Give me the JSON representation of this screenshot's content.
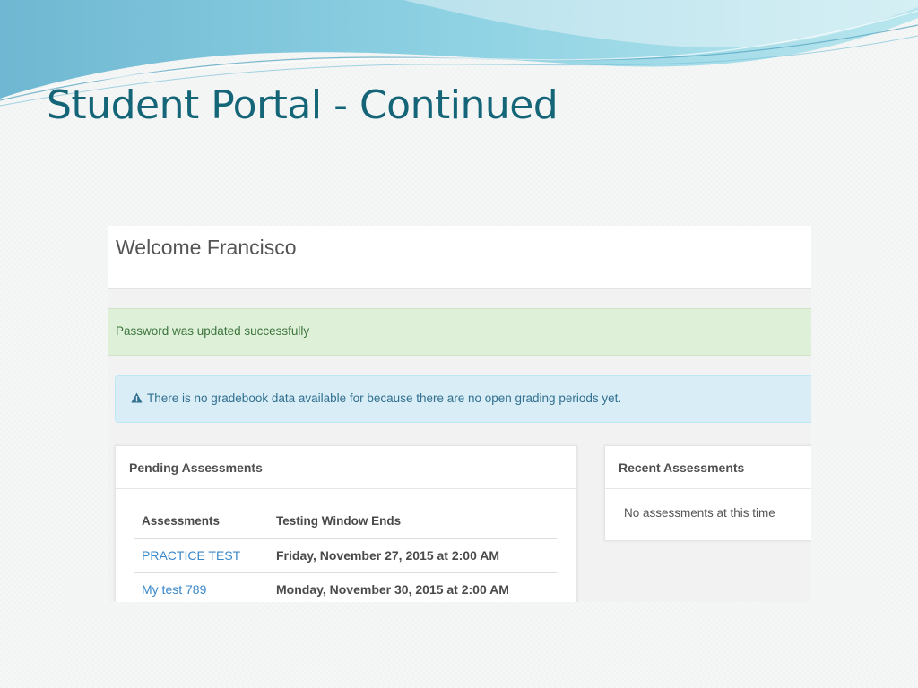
{
  "slide": {
    "title": "Student Portal - Continued"
  },
  "portal": {
    "welcome": "Welcome Francisco",
    "success_message": "Password was updated successfully",
    "info_message": "There is no gradebook data available for because there are no open grading periods yet.",
    "pending": {
      "title": "Pending Assessments",
      "columns": [
        "Assessments",
        "Testing Window Ends"
      ],
      "rows": [
        {
          "name": "PRACTICE TEST",
          "ends": "Friday, November 27, 2015 at 2:00 AM"
        },
        {
          "name": "My test 789",
          "ends": "Monday, November 30, 2015 at 2:00 AM"
        }
      ]
    },
    "recent": {
      "title": "Recent Assessments",
      "empty_message": "No assessments at this time"
    }
  },
  "icons": {
    "info_alert": "warning-triangle-icon"
  },
  "colors": {
    "title": "#136577",
    "success_bg": "#dff0d8",
    "success_text": "#3c763d",
    "info_bg": "#d9edf7",
    "info_text": "#31708f",
    "link": "#3a87c8"
  }
}
